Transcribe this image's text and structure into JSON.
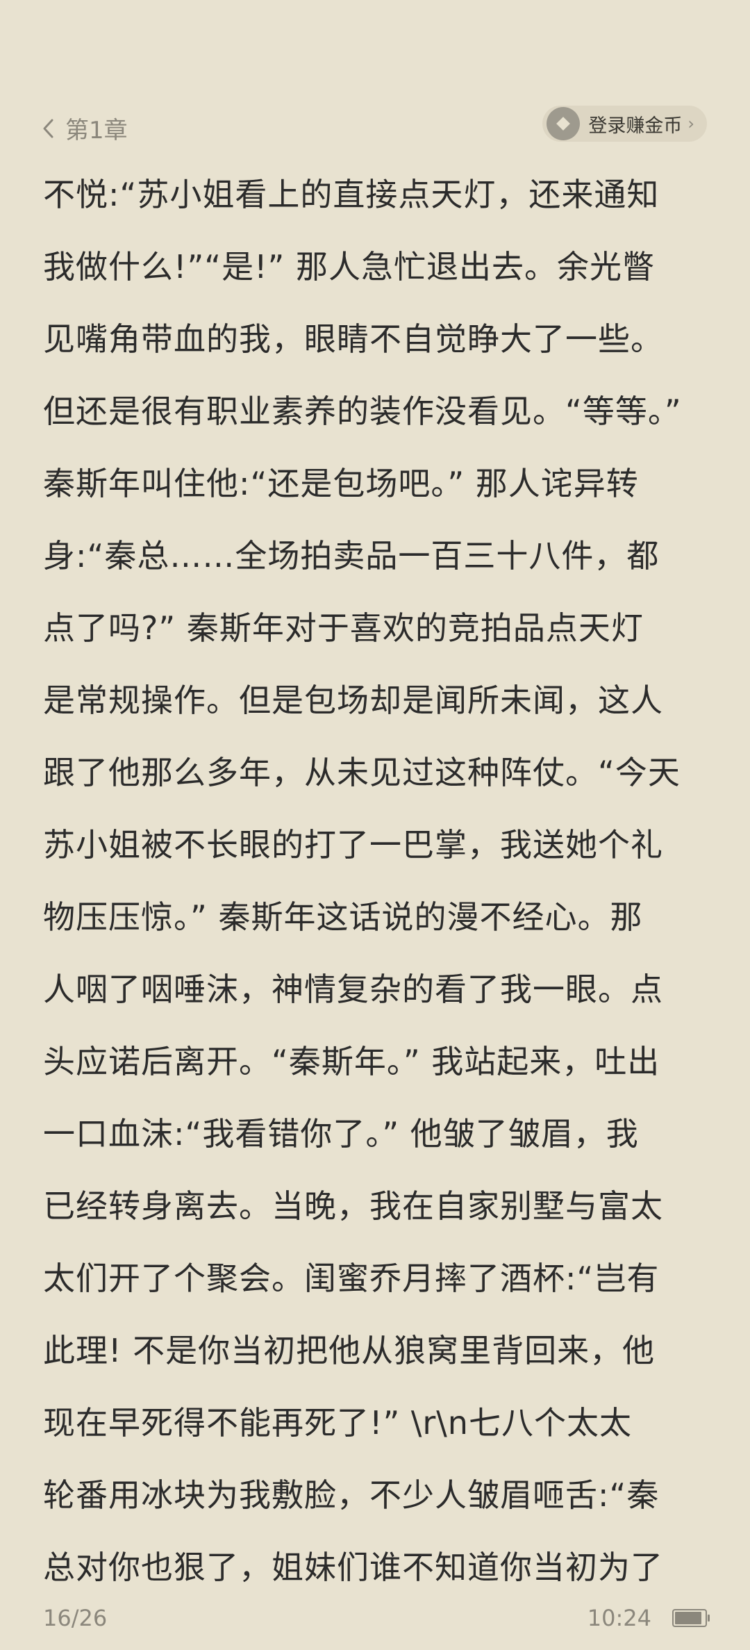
{
  "header": {
    "chapter": "第1章",
    "coin_button": "登录赚金币"
  },
  "content": {
    "lines": [
      "不悦:“苏小姐看上的直接点天灯，还来通知",
      "我做什么!”“是!” 那人急忙退出去。余光瞥",
      "见嘴角带血的我，眼睛不自觉睁大了一些。",
      "但还是很有职业素养的装作没看见。“等等。”",
      "秦斯年叫住他:“还是包场吧。” 那人诧异转",
      "身:“秦总……全场拍卖品一百三十八件，都",
      "点了吗?” 秦斯年对于喜欢的竞拍品点天灯",
      "是常规操作。但是包场却是闻所未闻，这人",
      "跟了他那么多年，从未见过这种阵仗。“今天",
      "苏小姐被不长眼的打了一巴掌，我送她个礼",
      "物压压惊。” 秦斯年这话说的漫不经心。那",
      "人咽了咽唾沫，神情复杂的看了我一眼。点",
      "头应诺后离开。“秦斯年。” 我站起来，吐出",
      "一口血沫:“我看错你了。” 他皱了皱眉，我",
      "已经转身离去。当晚，我在自家别墅与富太",
      "太们开了个聚会。闺蜜乔月摔了酒杯:“岂有",
      "此理! 不是你当初把他从狼窝里背回来，他",
      "现在早死得不能再死了!” \\r\\n七八个太太",
      "轮番用冰块为我敷脸，不少人皱眉咂舌:“秦",
      "总对你也狠了，姐妹们谁不知道你当初为了"
    ]
  },
  "footer": {
    "page": "16/26",
    "time": "10:24",
    "battery_level": 0.9
  }
}
